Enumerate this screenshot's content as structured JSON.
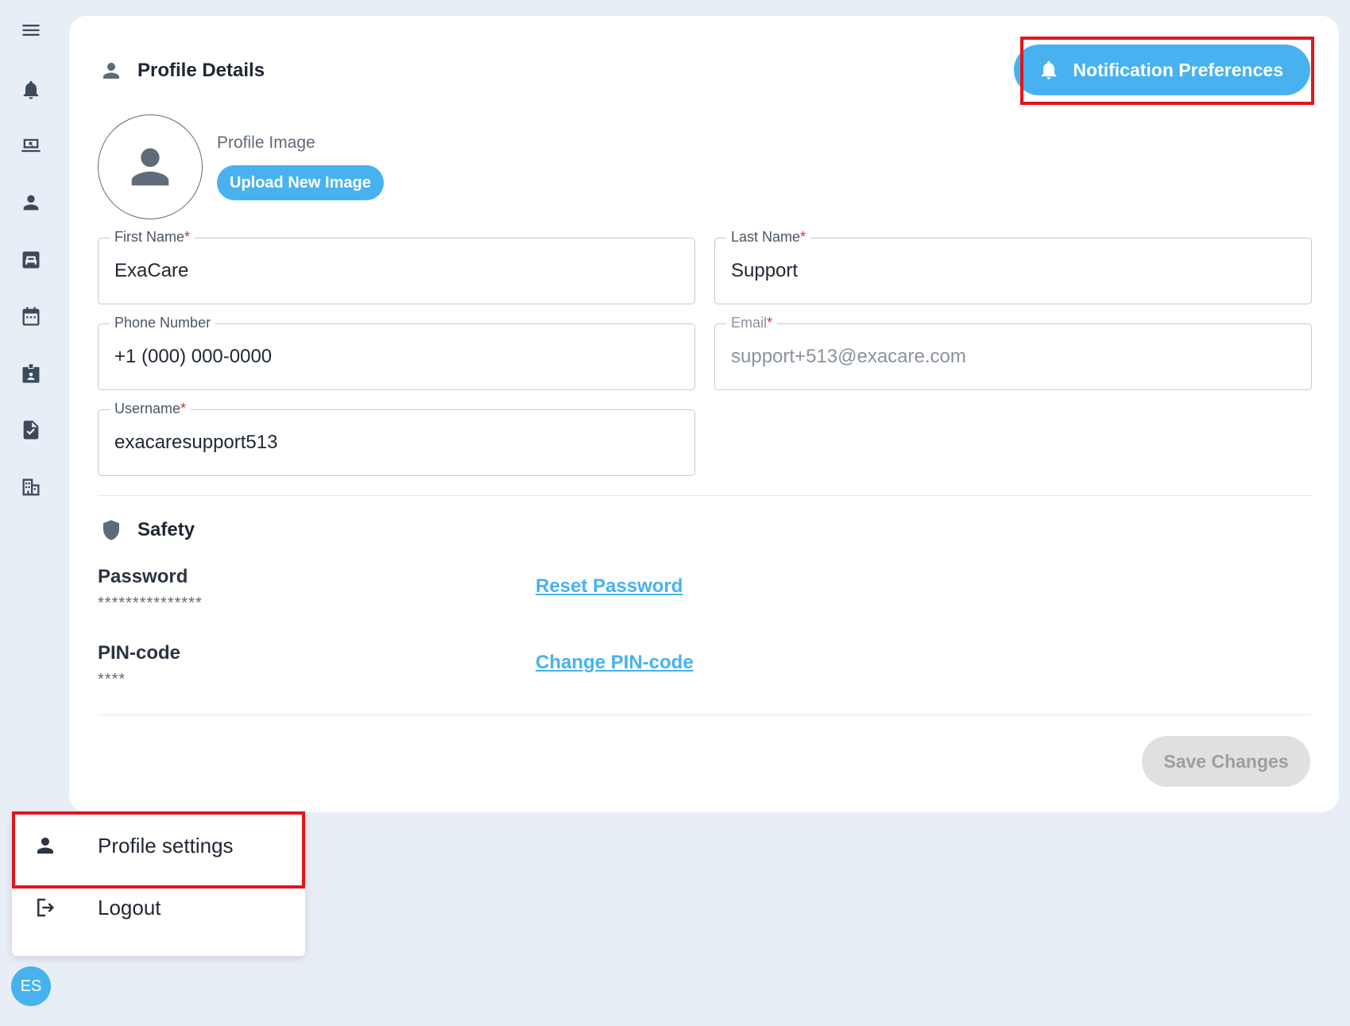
{
  "sidebar": {
    "items": [
      {
        "icon": "menu-icon"
      },
      {
        "icon": "bell-icon"
      },
      {
        "icon": "laptop-search-icon"
      },
      {
        "icon": "person-icon"
      },
      {
        "icon": "bed-icon"
      },
      {
        "icon": "calendar-icon"
      },
      {
        "icon": "staff-badge-icon"
      },
      {
        "icon": "document-check-icon"
      },
      {
        "icon": "building-icon"
      }
    ]
  },
  "profile": {
    "title": "Profile Details",
    "notification_button": "Notification Preferences",
    "image_label": "Profile Image",
    "upload_button": "Upload New Image",
    "fields": {
      "first_name": {
        "label": "First Name",
        "value": "ExaCare",
        "required": "*"
      },
      "last_name": {
        "label": "Last Name",
        "value": "Support",
        "required": "*"
      },
      "phone": {
        "label": "Phone Number",
        "value": "+1 (000) 000-0000"
      },
      "email": {
        "label": "Email",
        "value": "support+513@exacare.com",
        "required": "*"
      },
      "username": {
        "label": "Username",
        "value": "exacaresupport513",
        "required": "*"
      }
    }
  },
  "safety": {
    "title": "Safety",
    "password_label": "Password",
    "password_mask": "***************",
    "reset_password_link": "Reset Password",
    "pin_label": "PIN-code",
    "pin_mask": "****",
    "change_pin_link": "Change PIN-code"
  },
  "save_button": "Save Changes",
  "user_menu": {
    "items": [
      {
        "label": "Profile settings",
        "icon": "person-icon"
      },
      {
        "label": "Logout",
        "icon": "logout-icon"
      }
    ]
  },
  "user": {
    "initials": "ES"
  },
  "colors": {
    "accent": "#47b2ef",
    "highlight": "#e0161e",
    "background": "#e8eef6"
  }
}
